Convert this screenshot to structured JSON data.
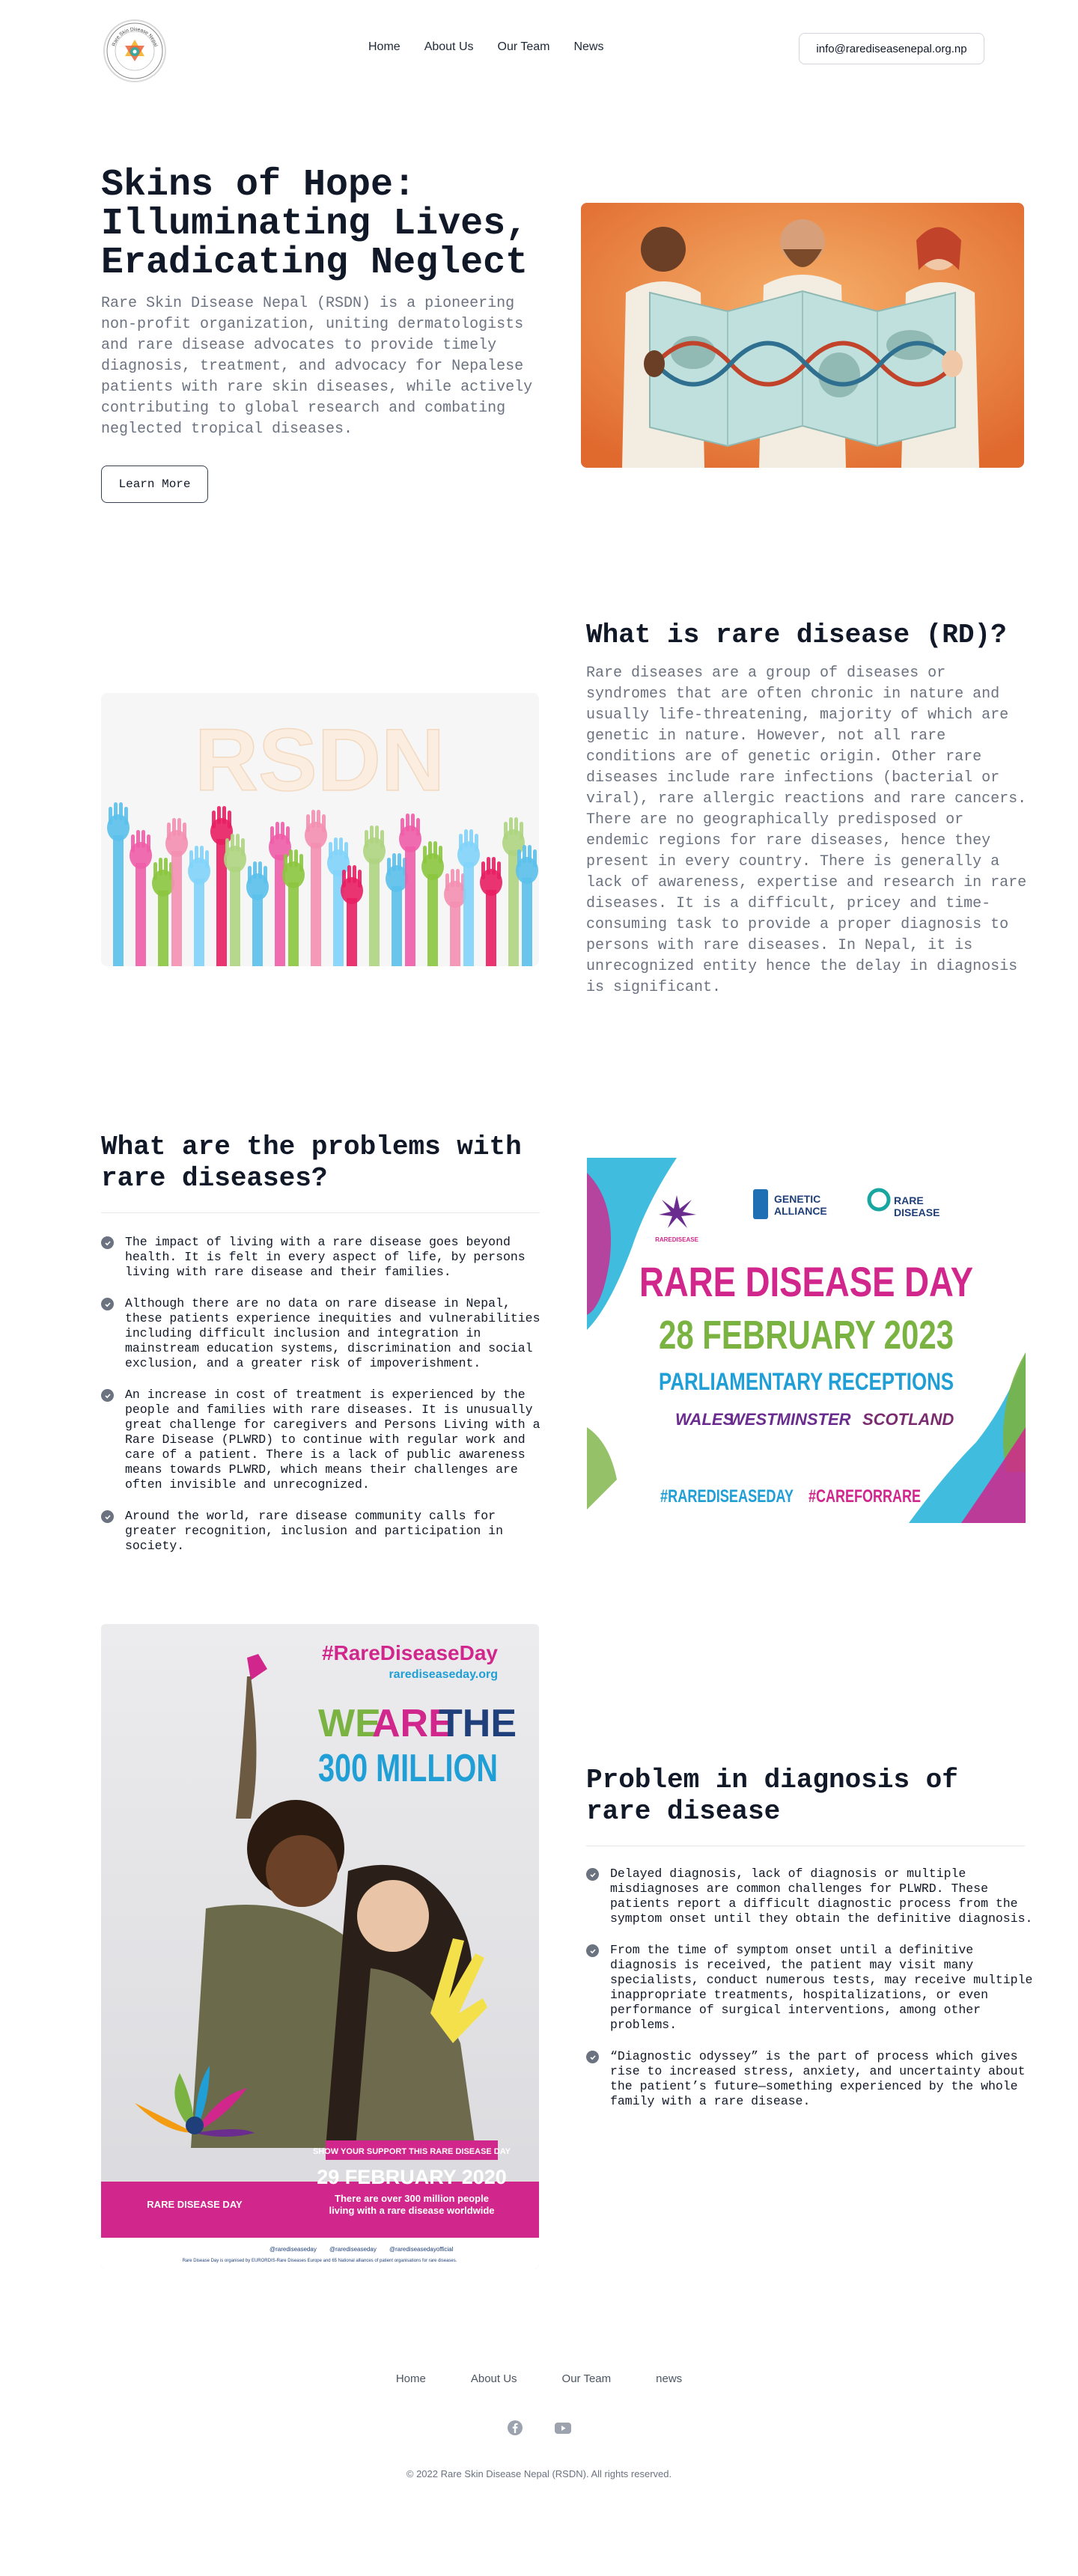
{
  "header": {
    "logo_text": "Rare Skin Disease Nepal",
    "nav": [
      "Home",
      "About Us",
      "Our Team",
      "News"
    ],
    "email": "info@rarediseasenepal.org.np"
  },
  "hero": {
    "title": "Skins of Hope: Illuminating Lives, Eradicating Neglect",
    "description": "Rare Skin Disease Nepal (RSDN) is a pioneering non-profit organization, uniting dermatologists and rare disease advocates to provide timely diagnosis, treatment, and advocacy for Nepalese patients with rare skin diseases, while actively contributing to global research and combating neglected tropical diseases.",
    "button": "Learn More",
    "slides": 4,
    "active_slide": 2
  },
  "rare_disease": {
    "image_text": "RSDN",
    "title": "What is rare disease (RD)?",
    "paragraphs": [
      "Rare diseases are a group of diseases or syndromes that are often chronic in nature and usually life-threatening, majority of which are genetic in nature. However, not all rare conditions are of genetic origin. Other rare diseases include rare infections (bacterial or viral), rare allergic reactions and rare cancers.",
      "There are no geographically predisposed or endemic regions for rare diseases, hence they present in every country. There is generally a lack of awareness, expertise and research in rare diseases. It is a difficult, pricey and time-consuming task to provide a proper diagnosis to persons with rare diseases. In Nepal, it is unrecognized entity hence the delay in diagnosis is significant."
    ]
  },
  "problems": {
    "title": "What are the problems with rare diseases?",
    "items": [
      "The impact of living with a rare disease goes beyond health. It is felt in every aspect of life, by persons living with rare disease and their families.",
      "Although there are no data on rare disease in Nepal, these patients experience inequities and vulnerabilities including difficult inclusion and integration in mainstream education systems, discrimination and social exclusion, and a greater risk of impoverishment.",
      "An increase in cost of treatment is experienced by the people and families with rare diseases. It is unusually great challenge for caregivers and Persons Living with a Rare Disease (PLWRD) to continue with regular work and care of a patient. There is a lack of public awareness means towards PLWRD, which means their challenges are often invisible and unrecognized.",
      "Around the world, rare disease community calls for greater recognition, inclusion and participation in society."
    ],
    "poster": {
      "logo1": "RAREDISEASE",
      "logo2a": "GENETIC",
      "logo2b": "ALLIANCE",
      "logo3a": "RARE",
      "logo3b": "DISEASE",
      "line1": "RARE DISEASE DAY",
      "line2": "28 FEBRUARY 2023",
      "line3": "PARLIAMENTARY RECEPTIONS",
      "places": [
        "WALES",
        "WESTMINSTER",
        "SCOTLAND"
      ],
      "tags": [
        "#RAREDISEASEDAY",
        "#CAREFORRARE"
      ],
      "colors": {
        "magenta": "#d1268c",
        "green": "#7ab342",
        "blue": "#1f9fd6",
        "purple": "#6b2c8f"
      }
    }
  },
  "diagnosis": {
    "title": "Problem in diagnosis of rare disease",
    "items": [
      "Delayed diagnosis, lack of diagnosis or multiple misdiagnoses are common challenges for PLWRD. These patients report a difficult diagnostic process from the symptom onset until they obtain the definitive diagnosis.",
      "From the time of symptom onset until a definitive diagnosis is received, the patient may visit many specialists, conduct numerous tests, may receive multiple inappropriate treatments, hospitalizations, or even performance of surgical interventions, among other problems.",
      "“Diagnostic odyssey” is the part of process which gives rise to increased stress, anxiety, and uncertainty about the patient’s future—something experienced by the whole family with a rare disease."
    ],
    "poster": {
      "hashtag": "#RareDiseaseDay",
      "url": "rarediseaseday.org",
      "we": "WE",
      "are": "ARE",
      "the": "THE",
      "million": "300 MILLION",
      "support": "SHOW YOUR SUPPORT THIS RARE DISEASE DAY",
      "date": "29 FEBRUARY 2020",
      "people1": "There are over 300 million people",
      "people2": "living with a rare disease worldwide",
      "brand": "RARE DISEASE DAY",
      "handles": [
        "@rarediseaseday",
        "@rarediseaseday",
        "@rarediseasedayofficial"
      ],
      "footnote": "Rare Disease Day is organised by EURORDIS-Rare Diseases Europe and 65 National alliances of patient organisations for rare diseases."
    }
  },
  "footer": {
    "nav": [
      "Home",
      "About Us",
      "Our Team",
      "news"
    ],
    "social": [
      "facebook-icon",
      "youtube-icon"
    ],
    "copyright": "© 2022 Rare Skin Disease Nepal (RSDN). All rights reserved."
  }
}
